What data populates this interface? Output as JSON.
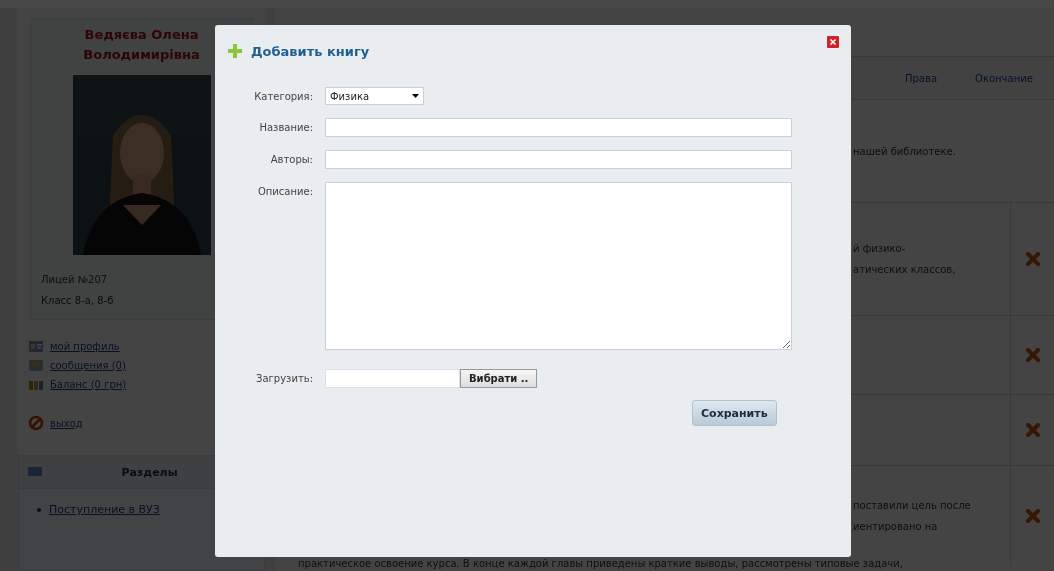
{
  "profile": {
    "name": "Ведяєва Олена Володимирівна",
    "school": "Лицей №207",
    "class": "Класс 8-а, 8-б"
  },
  "user_links": [
    {
      "kind": "profile",
      "label": "мой профиль"
    },
    {
      "kind": "messages",
      "label": "сообщения (0)"
    },
    {
      "kind": "balance",
      "label": "Баланс (0 грн)"
    },
    {
      "kind": "logout",
      "label": "выход"
    }
  ],
  "sections": {
    "title": "Разделы",
    "items": [
      "Поступление в ВУЗ"
    ]
  },
  "steps": [
    "Права",
    "Окончание"
  ],
  "intro": "нашей библиотеке.",
  "rows": [
    {
      "lines": [
        "й физико-",
        "атических классов,"
      ]
    },
    {
      "lines": []
    },
    {
      "lines": []
    },
    {
      "lines": [
        "поставили цель после",
        "иентировано на"
      ]
    }
  ],
  "bottom_line": "практическое освоение курса. В конце каждой главы приведены краткие выводы, рассмотрены типовые задачи,",
  "dialog": {
    "title": "Добавить книгу",
    "fields": [
      {
        "kind": "select",
        "label": "Категория:",
        "value": "Физика"
      },
      {
        "kind": "text",
        "label": "Название:"
      },
      {
        "kind": "text",
        "label": "Авторы:"
      },
      {
        "kind": "textarea",
        "label": "Описание:"
      },
      {
        "kind": "file",
        "label": "Загрузить:",
        "button": "Вибрати .."
      }
    ],
    "save": "Сохранить"
  }
}
